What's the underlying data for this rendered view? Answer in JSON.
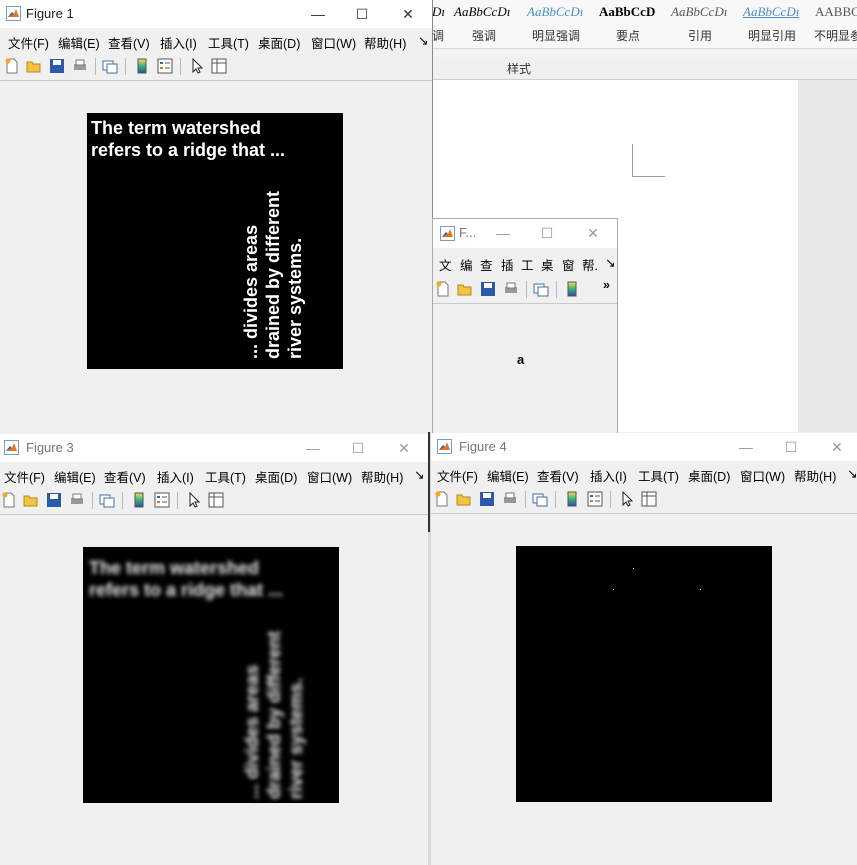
{
  "word": {
    "style_previews": [
      "Dı",
      "AaBbCcDı",
      "AaBbCcDı",
      "AaBbCcD",
      "AaBbCcDı",
      "AaBbCcDı",
      "AABBCc"
    ],
    "style_names": [
      "调",
      "强调",
      "明显强调",
      "要点",
      "引用",
      "明显引用",
      "不明显参"
    ],
    "group_label": "样式"
  },
  "figure1": {
    "title": "Figure 1",
    "menu": [
      "文件(F)",
      "编辑(E)",
      "查看(V)",
      "插入(I)",
      "工具(T)",
      "桌面(D)",
      "窗口(W)",
      "帮助(H)"
    ],
    "overflow": "↘",
    "text_line1": "The term watershed",
    "text_line2": "refers to a ridge that ...",
    "rot_line1": "... divides areas",
    "rot_line2": "drained by different",
    "rot_line3": "river systems."
  },
  "figure_small": {
    "title": "F...",
    "menu": [
      "文",
      "编",
      "查",
      "插",
      "工",
      "桌",
      "窗",
      "帮.",
      "↘"
    ],
    "overflow": "»",
    "canvas_glyph": "a"
  },
  "figure3": {
    "title": "Figure 3",
    "menu": [
      "文件(F)",
      "编辑(E)",
      "查看(V)",
      "插入(I)",
      "工具(T)",
      "桌面(D)",
      "窗口(W)",
      "帮助(H)"
    ],
    "overflow": "↘",
    "text_line1": "The term watershed",
    "text_line2": "refers to a ridge that ...",
    "rot_line1": "... divides areas",
    "rot_line2": "drained by different",
    "rot_line3": "river systems."
  },
  "figure4": {
    "title": "Figure 4",
    "menu": [
      "文件(F)",
      "编辑(E)",
      "查看(V)",
      "插入(I)",
      "工具(T)",
      "桌面(D)",
      "窗口(W)",
      "帮助(H)"
    ],
    "overflow": "↘"
  },
  "window_controls": {
    "minimize": "—",
    "maximize": "☐",
    "close": "✕"
  },
  "colors": {
    "canvas": "#000000",
    "text": "#ffffff",
    "matlab_orange": "#e8731f",
    "matlab_blue": "#2b6cb0"
  }
}
